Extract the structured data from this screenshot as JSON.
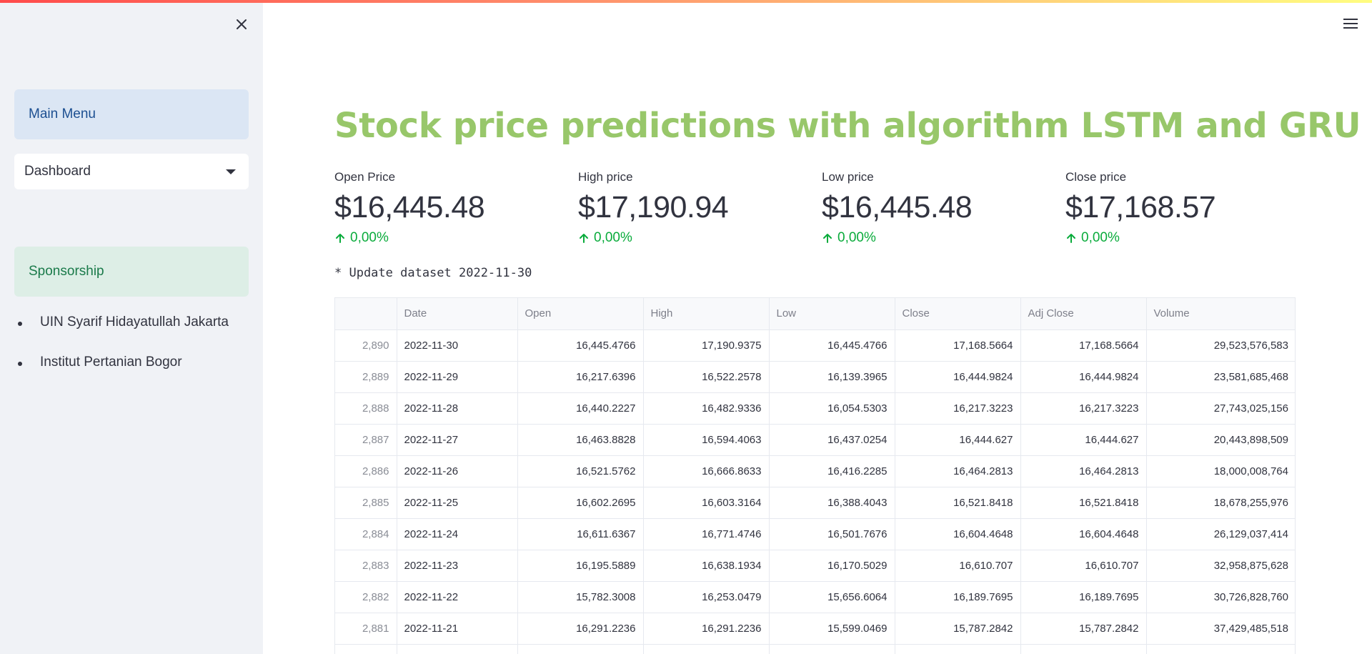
{
  "sidebar": {
    "main_menu_label": "Main Menu",
    "selected_page": "Dashboard",
    "sponsorship_label": "Sponsorship",
    "sponsors": [
      "UIN Syarif Hidayatullah Jakarta",
      "Institut Pertanian Bogor"
    ]
  },
  "main": {
    "title": "Stock price predictions with algorithm LSTM and GRU",
    "metrics": [
      {
        "label": "Open Price",
        "value": "$16,445.48",
        "delta": "0,00%"
      },
      {
        "label": "High price",
        "value": "$17,190.94",
        "delta": "0,00%"
      },
      {
        "label": "Low price",
        "value": "$16,445.48",
        "delta": "0,00%"
      },
      {
        "label": "Close price",
        "value": "$17,168.57",
        "delta": "0,00%"
      }
    ],
    "update_note": "* Update dataset 2022-11-30",
    "table": {
      "columns": [
        "",
        "Date",
        "Open",
        "High",
        "Low",
        "Close",
        "Adj Close",
        "Volume"
      ],
      "rows": [
        [
          "2,890",
          "2022-11-30",
          "16,445.4766",
          "17,190.9375",
          "16,445.4766",
          "17,168.5664",
          "17,168.5664",
          "29,523,576,583"
        ],
        [
          "2,889",
          "2022-11-29",
          "16,217.6396",
          "16,522.2578",
          "16,139.3965",
          "16,444.9824",
          "16,444.9824",
          "23,581,685,468"
        ],
        [
          "2,888",
          "2022-11-28",
          "16,440.2227",
          "16,482.9336",
          "16,054.5303",
          "16,217.3223",
          "16,217.3223",
          "27,743,025,156"
        ],
        [
          "2,887",
          "2022-11-27",
          "16,463.8828",
          "16,594.4063",
          "16,437.0254",
          "16,444.627",
          "16,444.627",
          "20,443,898,509"
        ],
        [
          "2,886",
          "2022-11-26",
          "16,521.5762",
          "16,666.8633",
          "16,416.2285",
          "16,464.2813",
          "16,464.2813",
          "18,000,008,764"
        ],
        [
          "2,885",
          "2022-11-25",
          "16,602.2695",
          "16,603.3164",
          "16,388.4043",
          "16,521.8418",
          "16,521.8418",
          "18,678,255,976"
        ],
        [
          "2,884",
          "2022-11-24",
          "16,611.6367",
          "16,771.4746",
          "16,501.7676",
          "16,604.4648",
          "16,604.4648",
          "26,129,037,414"
        ],
        [
          "2,883",
          "2022-11-23",
          "16,195.5889",
          "16,638.1934",
          "16,170.5029",
          "16,610.707",
          "16,610.707",
          "32,958,875,628"
        ],
        [
          "2,882",
          "2022-11-22",
          "15,782.3008",
          "16,253.0479",
          "15,656.6064",
          "16,189.7695",
          "16,189.7695",
          "30,726,828,760"
        ],
        [
          "2,881",
          "2022-11-21",
          "16,291.2236",
          "16,291.2236",
          "15,599.0469",
          "15,787.2842",
          "15,787.2842",
          "37,429,485,518"
        ],
        [
          "",
          "",
          "",
          "",
          "",
          "",
          "",
          ""
        ]
      ]
    }
  },
  "colors": {
    "title": "#98c76a",
    "delta": "#09ab3b",
    "sidebar_bg": "#f0f2f6",
    "info_blue_bg": "#dbe6f4",
    "info_green_bg": "#ddeee6"
  },
  "icons": [
    "close-icon",
    "hamburger-menu-icon",
    "chevron-down-icon",
    "arrow-up-icon"
  ]
}
